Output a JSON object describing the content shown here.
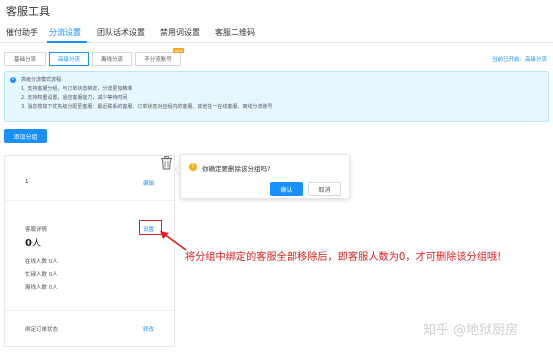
{
  "app": {
    "title": "客服工具"
  },
  "nav": {
    "tabs": [
      {
        "label": "催付助手",
        "active": false
      },
      {
        "label": "分流设置",
        "active": true
      },
      {
        "label": "团队话术设置",
        "active": false
      },
      {
        "label": "禁用词设置",
        "active": false
      },
      {
        "label": "客服二维码",
        "active": false
      }
    ]
  },
  "subtabs": {
    "items": [
      {
        "label": "基础分流",
        "active": false
      },
      {
        "label": "高级分流",
        "active": true
      },
      {
        "label": "离线分流",
        "active": false
      },
      {
        "label": "不分流账号",
        "active": false,
        "badge": "new"
      }
    ],
    "current_mode": "当前已开启：高级分流"
  },
  "info": {
    "icon": "info-icon",
    "lines": [
      "高级分流模式流程:",
      "1. 支持客服分组，与订单状态绑定，分流更加精准",
      "2. 支持权重设置，适应客服能力，减少等待时间",
      "3. 消息按如下优先级分配至客服：最近联系的客服、订单状态对应组内的客服、其他任一在线客服、离线分流账号"
    ]
  },
  "actions": {
    "add_group": "添加分组"
  },
  "group_card": {
    "name": "1",
    "edit_label": "编辑",
    "agent_detail_label": "客服详情",
    "settings_label": "设置",
    "agent_count": "0",
    "agent_unit": "人",
    "online_label": "在线人数 0人",
    "busy_label": "忙碌人数 0人",
    "offline_label": "离线人数 0人",
    "order_status_label": "绑定订单状态",
    "modify_label": "修改"
  },
  "popconfirm": {
    "message": "你确定要删除该分组吗?",
    "ok_label": "确认",
    "cancel_label": "取消"
  },
  "annotation": {
    "text": "将分组中绑定的客服全部移除后，即客服人数为0，才可删除该分组哦!"
  },
  "watermark": {
    "text": "知乎 @地狱厨房"
  },
  "colors": {
    "accent": "#1890ff",
    "highlight": "#e02020",
    "warning": "#faad14",
    "info_bg": "#e6f7ff"
  }
}
